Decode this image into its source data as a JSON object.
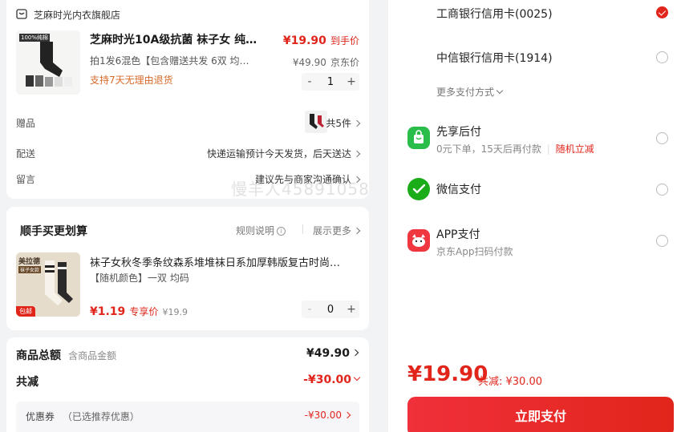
{
  "shop": {
    "name": "芝麻时光内衣旗舰店"
  },
  "product": {
    "title": "芝麻时光10A级抗菌 袜子女 纯…",
    "spec": "拍1发6混色【包含赠送共发 6双  均…",
    "return_policy": "支持7天无理由退货",
    "price": "¥19.90",
    "price_tag": "到手价",
    "jd_price": "¥49.90",
    "jd_price_label": "京东价",
    "quantity": "1",
    "thumb_label": "100%纯棉"
  },
  "gift": {
    "label": "赠品",
    "count": "共5件"
  },
  "delivery": {
    "label": "配送",
    "value": "快递运输预计今天发货，后天送达"
  },
  "message": {
    "label": "留言",
    "value": "建议先与商家沟通确认"
  },
  "watermark": "慢羊人45891058",
  "upsell": {
    "title": "顺手买更划算",
    "rules": "规则说明",
    "more": "展示更多",
    "item": {
      "title": "袜子女秋冬季条纹森系堆堆袜日系加厚韩版复古时尚…",
      "spec": "【随机颜色】一双 均码",
      "price": "¥1.19",
      "price_tag": "专享价",
      "orig_price": "¥19.9",
      "quantity": "0",
      "thumb_label": "美拉德",
      "thumb_sub": "袜子女款",
      "thumb_badge": "包邮"
    }
  },
  "summary": {
    "total_label": "商品总额",
    "total_sub": "含商品金额",
    "total_value": "¥49.90",
    "discount_label": "共减",
    "discount_value": "-¥30.00",
    "coupon_label": "优惠券",
    "coupon_sub": "（已选推荐优惠）",
    "coupon_value": "-¥30.00"
  },
  "payment": {
    "methods": [
      {
        "label": "工商银行信用卡(0025)",
        "checked": true
      },
      {
        "label": "中信银行信用卡(1914)",
        "checked": false
      }
    ],
    "more_methods": "更多支付方式",
    "later": {
      "label": "先享后付",
      "sub": "0元下单，15天后再付款",
      "promo": "随机立减"
    },
    "wechat": {
      "label": "微信支付"
    },
    "app": {
      "label": "APP支付",
      "sub": "京东App扫码付款"
    },
    "total": "¥19.90",
    "saved": "共减: ¥30.00",
    "pay_button": "立即支付"
  },
  "colors": {
    "accent": "#e1251b",
    "wechat": "#1aad19",
    "later": "#2bbd4a",
    "app": "#f0373f"
  }
}
